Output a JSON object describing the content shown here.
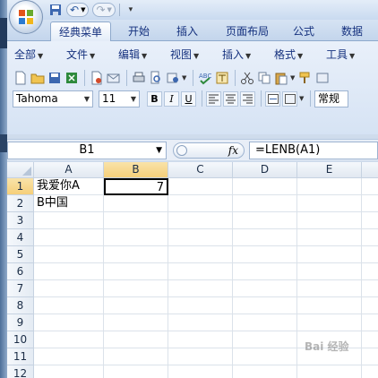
{
  "tabs": [
    {
      "label": "经典菜单",
      "active": true
    },
    {
      "label": "开始"
    },
    {
      "label": "插入"
    },
    {
      "label": "页面布局"
    },
    {
      "label": "公式"
    },
    {
      "label": "数据"
    }
  ],
  "menus": [
    {
      "label": "全部"
    },
    {
      "label": "文件"
    },
    {
      "label": "编辑"
    },
    {
      "label": "视图"
    },
    {
      "label": "插入"
    },
    {
      "label": "格式"
    },
    {
      "label": "工具"
    }
  ],
  "toolbar": {
    "font": "Tahoma",
    "size": "11",
    "bold": "B",
    "italic": "I",
    "underline": "U",
    "number_format": "常规"
  },
  "formula_bar": {
    "name_box": "B1",
    "fx": "fx",
    "formula": "=LENB(A1)"
  },
  "grid": {
    "columns": [
      "A",
      "B",
      "C",
      "D",
      "E"
    ],
    "rows": [
      "1",
      "2",
      "3",
      "4",
      "5",
      "6",
      "7",
      "8",
      "9",
      "10",
      "11",
      "12"
    ],
    "cells": {
      "A1": "我爱你A",
      "B1": "7",
      "A2": "B中国"
    },
    "active_cell": "B1"
  },
  "colors": {
    "accent": "#15317e",
    "selection_header": "#f5cf7a"
  }
}
